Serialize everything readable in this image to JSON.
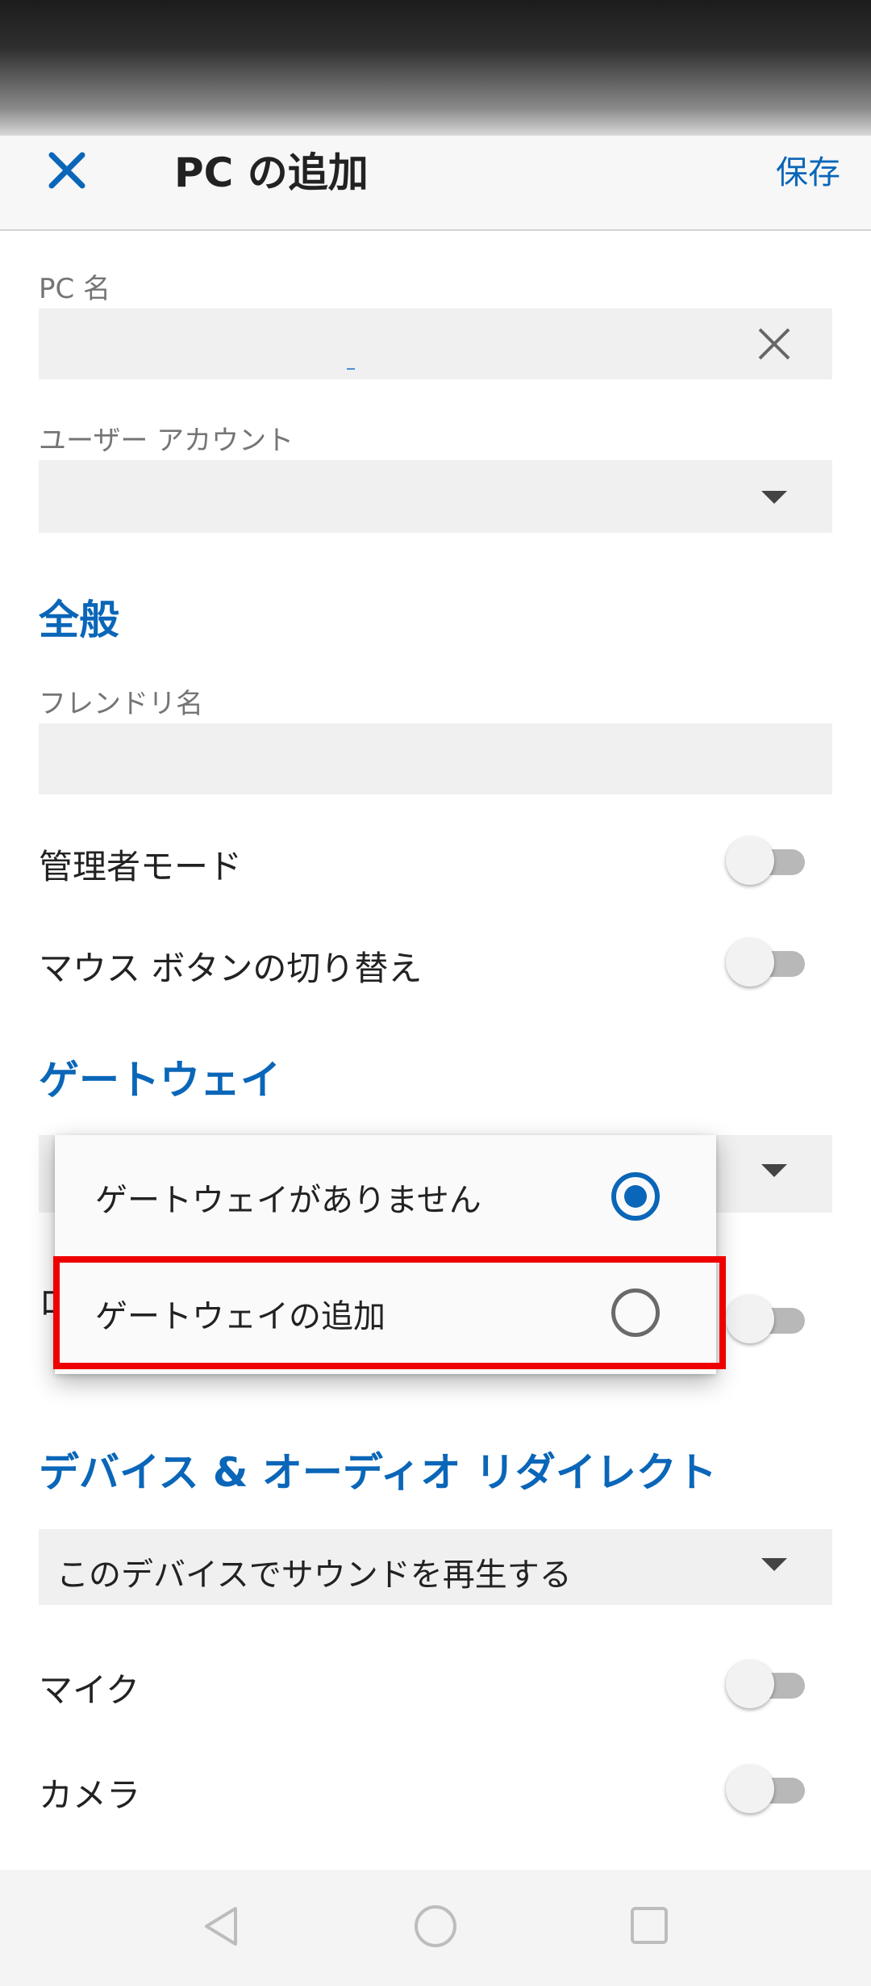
{
  "header": {
    "title": "PC の追加",
    "save_label": "保存"
  },
  "form": {
    "pc_name_label": "PC 名",
    "pc_name_value": "",
    "user_account_label": "ユーザー アカウント",
    "user_account_value": ""
  },
  "general": {
    "title": "全般",
    "friendly_name_label": "フレンドリ名",
    "friendly_name_value": "",
    "admin_mode_label": "管理者モード",
    "admin_mode_on": false,
    "swap_mouse_label": "マウス ボタンの切り替え",
    "swap_mouse_on": false
  },
  "gateway": {
    "title": "ゲートウェイ",
    "hidden_row_char": "ロ",
    "options": [
      {
        "label": "ゲートウェイがありません",
        "selected": true
      },
      {
        "label": "ゲートウェイの追加",
        "selected": false
      }
    ]
  },
  "redirect": {
    "title": "デバイス & オーディオ リダイレクト",
    "audio_value": "このデバイスでサウンドを再生する",
    "mic_label": "マイク",
    "mic_on": false,
    "camera_label": "カメラ",
    "camera_on": false
  },
  "colors": {
    "accent": "#0a66b8",
    "highlight": "#ee0000"
  },
  "icons": {
    "close": "close-icon",
    "clear": "clear-icon",
    "dropdown": "caret-down-icon",
    "nav_back": "back-icon",
    "nav_home": "home-icon",
    "nav_recent": "recents-icon"
  }
}
